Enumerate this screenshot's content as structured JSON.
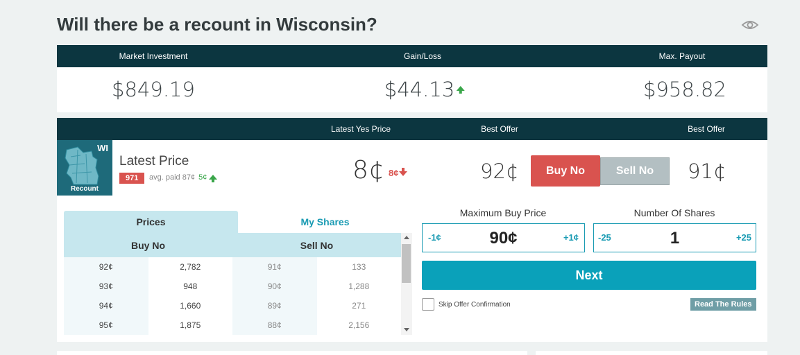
{
  "page": {
    "title": "Will there be a recount in Wisconsin?"
  },
  "summary": {
    "headers": [
      "Market Investment",
      "Gain/Loss",
      "Max. Payout"
    ],
    "investment": "$849.19",
    "gain_loss": "$44.13",
    "max_payout": "$958.82",
    "gain_color": "#3aa64a"
  },
  "contract": {
    "headers": {
      "latest_yes_price": "Latest Yes Price",
      "best_offer_no": "Best Offer",
      "best_offer_yes": "Best Offer"
    },
    "thumb": {
      "code": "WI",
      "label": "Recount"
    },
    "latest_label": "Latest Price",
    "shares_badge": "971",
    "avg_paid": "avg. paid 87¢",
    "avg_change": "5¢",
    "yes_price": "8¢",
    "yes_change": "8¢",
    "best_offer_no": "92¢",
    "best_offer_yes": "91¢",
    "buy_no_label": "Buy No",
    "sell_no_label": "Sell No"
  },
  "tabs": {
    "prices": "Prices",
    "my_shares": "My Shares"
  },
  "order_book": {
    "headers": [
      "Buy No",
      "Sell No"
    ],
    "rows": [
      [
        "92¢",
        "2,782",
        "91¢",
        "133"
      ],
      [
        "93¢",
        "948",
        "90¢",
        "1,288"
      ],
      [
        "94¢",
        "1,660",
        "89¢",
        "271"
      ],
      [
        "95¢",
        "1,875",
        "88¢",
        "2,156"
      ]
    ]
  },
  "order_form": {
    "max_price_label": "Maximum Buy Price",
    "price_minus": "-1¢",
    "price_value": "90¢",
    "price_plus": "+1¢",
    "shares_label": "Number Of Shares",
    "shares_minus": "-25",
    "shares_value": "1",
    "shares_plus": "+25",
    "next_label": "Next",
    "skip_label": "Skip Offer Confirmation",
    "rules_label": "Read The Rules"
  },
  "colors": {
    "header_bg": "#0c3640",
    "accent": "#0aa1ba",
    "buy_no": "#d9534f",
    "sell_no": "#b3bfc2"
  },
  "icons": [
    "eye-icon",
    "up-arrow-icon",
    "down-arrow-icon",
    "wisconsin-map-icon"
  ]
}
